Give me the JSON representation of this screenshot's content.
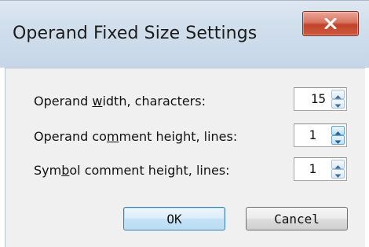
{
  "window": {
    "title": "Operand Fixed Size Settings",
    "close_icon": "close-x-icon"
  },
  "fields": [
    {
      "label_pre": "Operand ",
      "label_mnemonic": "w",
      "label_post": "idth, characters:",
      "value": "15"
    },
    {
      "label_pre": "Operand co",
      "label_mnemonic": "m",
      "label_post": "ment height, lines:",
      "value": "1"
    },
    {
      "label_pre": "Sym",
      "label_mnemonic": "b",
      "label_post": "ol comment height, lines:",
      "value": "1"
    }
  ],
  "buttons": {
    "ok_label": "OK",
    "cancel_label": "Cancel"
  },
  "colors": {
    "close_button": "#c04328",
    "ok_border": "#3c7fb1",
    "client_bg": "#f0f0f0"
  }
}
